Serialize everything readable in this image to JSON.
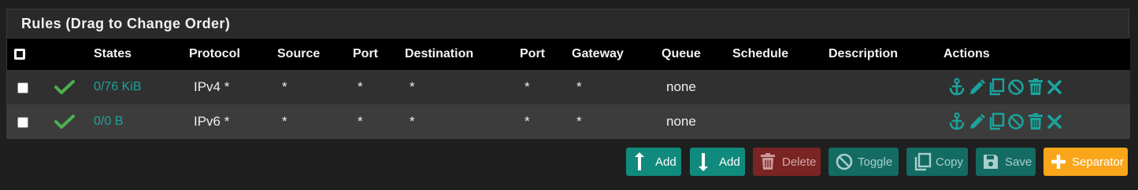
{
  "panel": {
    "title": "Rules (Drag to Change Order)"
  },
  "table": {
    "headers": {
      "states": "States",
      "protocol": "Protocol",
      "source": "Source",
      "port": "Port",
      "destination": "Destination",
      "port2": "Port",
      "gateway": "Gateway",
      "queue": "Queue",
      "schedule": "Schedule",
      "description": "Description",
      "actions": "Actions"
    },
    "rows": [
      {
        "states": "0/76 KiB",
        "protocol": "IPv4 *",
        "source": "*",
        "port": "*",
        "destination": "*",
        "port2": "*",
        "gateway": "*",
        "queue": "none",
        "schedule": "",
        "description": ""
      },
      {
        "states": "0/0 B",
        "protocol": "IPv6 *",
        "source": "*",
        "port": "*",
        "destination": "*",
        "port2": "*",
        "gateway": "*",
        "queue": "none",
        "schedule": "",
        "description": ""
      }
    ],
    "action_icons": [
      "anchor-icon",
      "pencil-icon",
      "copy-icon",
      "disable-icon",
      "trash-icon",
      "close-icon"
    ]
  },
  "buttons": {
    "add_top": "Add",
    "add_bottom": "Add",
    "delete": "Delete",
    "toggle": "Toggle",
    "copy": "Copy",
    "save": "Save",
    "separator": "Separator"
  },
  "colors": {
    "accent": "#1ba39c",
    "check": "#4caf50",
    "add_button": "#118a7e",
    "delete_button": "#7a2424",
    "separator_button": "#f9a61a",
    "header_bg": "#000000"
  }
}
